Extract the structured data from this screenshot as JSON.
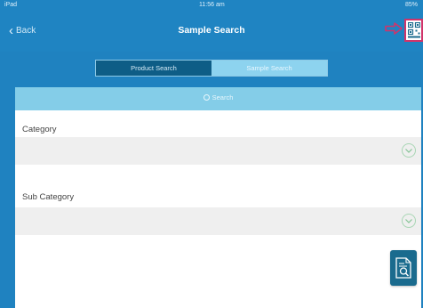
{
  "status_bar": {
    "carrier": "iPad",
    "time": "11:56 am",
    "battery": "85%"
  },
  "nav": {
    "back_label": "Back",
    "title": "Sample Search"
  },
  "segments": [
    {
      "label": "Product Search",
      "active": true
    },
    {
      "label": "Sample Search",
      "active": false
    }
  ],
  "search": {
    "placeholder": "Search"
  },
  "fields": [
    {
      "label": "Category",
      "value": ""
    },
    {
      "label": "Sub Category",
      "value": ""
    }
  ],
  "colors": {
    "brand_blue": "#1f84c2",
    "highlight": "#d0346a",
    "accent_green": "#a8d6b4"
  },
  "icons": {
    "back": "chevron-left-icon",
    "scan": "qr-scan-icon",
    "dropdown": "chevron-down-circle-icon",
    "report": "document-search-icon",
    "pointer": "arrow-right-icon"
  }
}
